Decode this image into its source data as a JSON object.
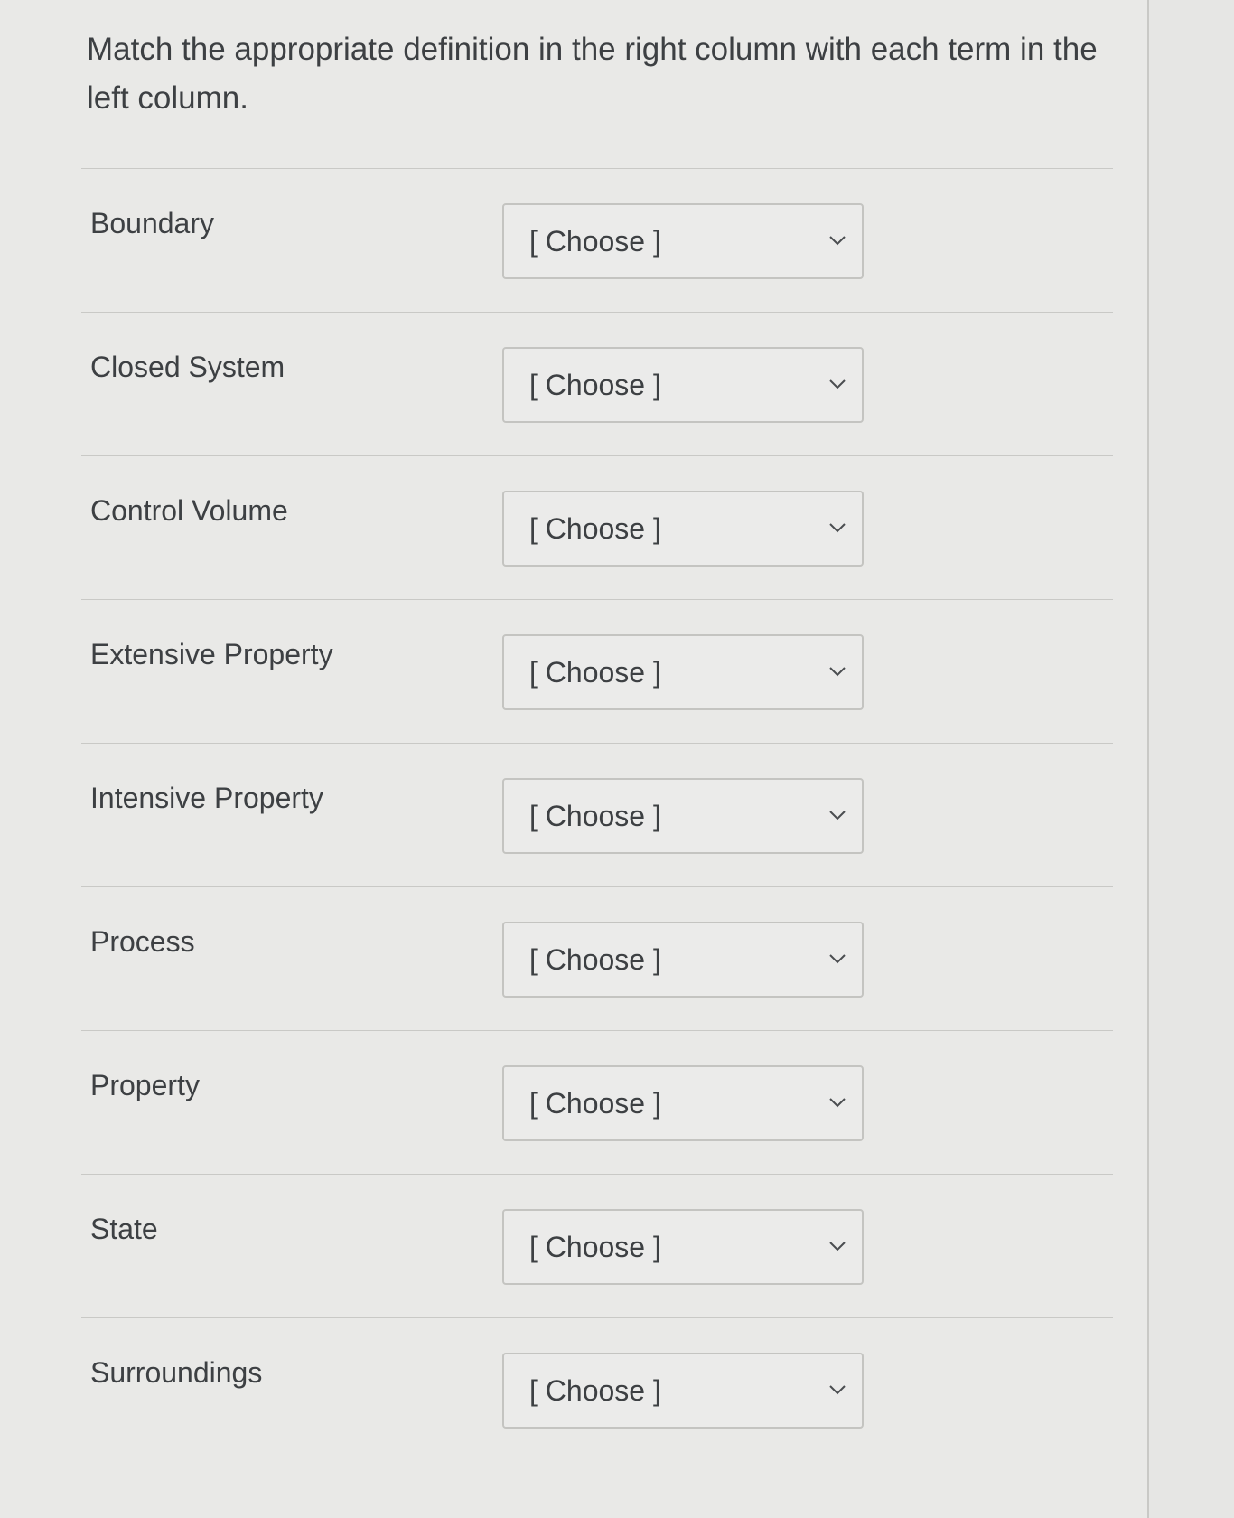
{
  "question": {
    "text": "Match the appropriate definition in the right column with each term in the left column."
  },
  "rows": [
    {
      "term": "Boundary",
      "selected": "[ Choose ]"
    },
    {
      "term": "Closed System",
      "selected": "[ Choose ]"
    },
    {
      "term": "Control Volume",
      "selected": "[ Choose ]"
    },
    {
      "term": "Extensive Property",
      "selected": "[ Choose ]"
    },
    {
      "term": "Intensive Property",
      "selected": "[ Choose ]"
    },
    {
      "term": "Process",
      "selected": "[ Choose ]"
    },
    {
      "term": "Property",
      "selected": "[ Choose ]"
    },
    {
      "term": "State",
      "selected": "[ Choose ]"
    },
    {
      "term": "Surroundings",
      "selected": "[ Choose ]"
    }
  ],
  "icons": {
    "dropdown": "chevron-down-icon"
  },
  "colors": {
    "background": "#e9e9e7",
    "text": "#3d4043",
    "border": "#c4c4c1"
  }
}
